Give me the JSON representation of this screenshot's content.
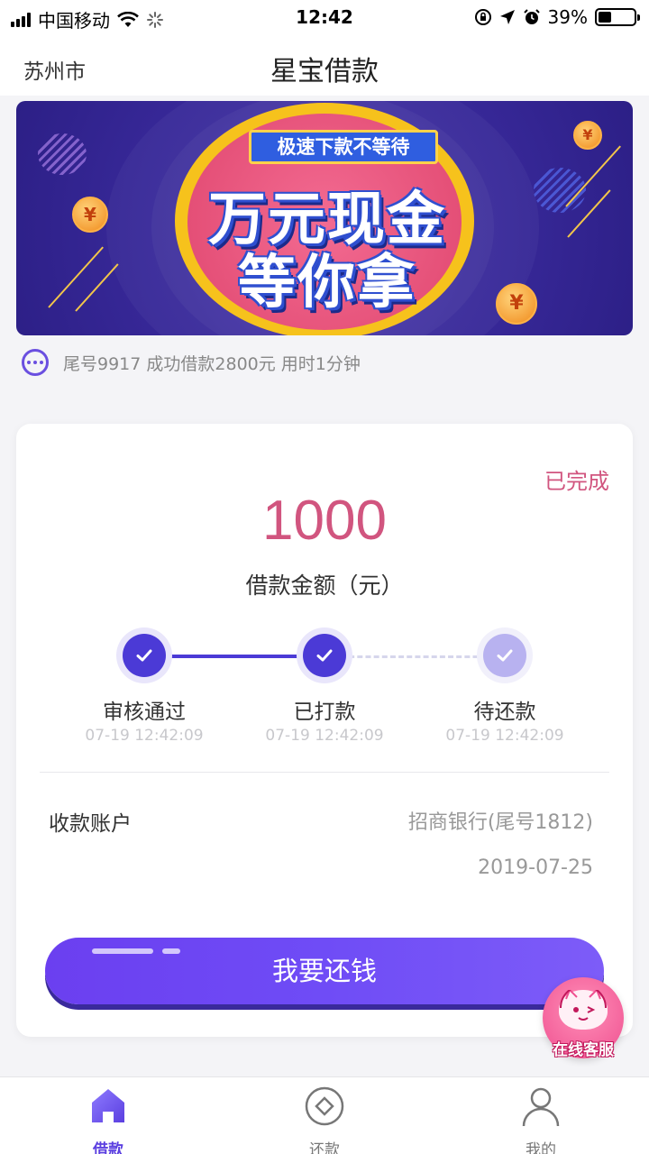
{
  "status_bar": {
    "carrier": "中国移动",
    "time": "12:42",
    "battery": "39%"
  },
  "header": {
    "city": "苏州市",
    "title": "星宝借款"
  },
  "banner": {
    "tag": "极速下款不等待",
    "line1": "万元现金",
    "line2": "等你拿",
    "coin_symbol": "¥"
  },
  "notice": {
    "text": "尾号9917 成功借款2800元 用时1分钟"
  },
  "loan": {
    "status": "已完成",
    "amount": "1000",
    "amount_label": "借款金额（元）",
    "steps": [
      {
        "name": "审核通过",
        "time": "07-19 12:42:09",
        "state": "done"
      },
      {
        "name": "已打款",
        "time": "07-19 12:42:09",
        "state": "done"
      },
      {
        "name": "待还款",
        "time": "07-19 12:42:09",
        "state": "pending"
      }
    ],
    "account_label": "收款账户",
    "account_value": "招商银行(尾号1812)",
    "due_date": "2019-07-25",
    "repay_button": "我要还钱"
  },
  "customer_service": {
    "label": "在线客服"
  },
  "tabbar": {
    "items": [
      {
        "label": "借款",
        "icon": "home-icon",
        "active": true
      },
      {
        "label": "还款",
        "icon": "repay-icon",
        "active": false
      },
      {
        "label": "我的",
        "icon": "profile-icon",
        "active": false
      }
    ]
  },
  "colors": {
    "accent": "#5b3fe0",
    "status_pink": "#d1557f",
    "banner_bg": "#3a2a9c"
  }
}
